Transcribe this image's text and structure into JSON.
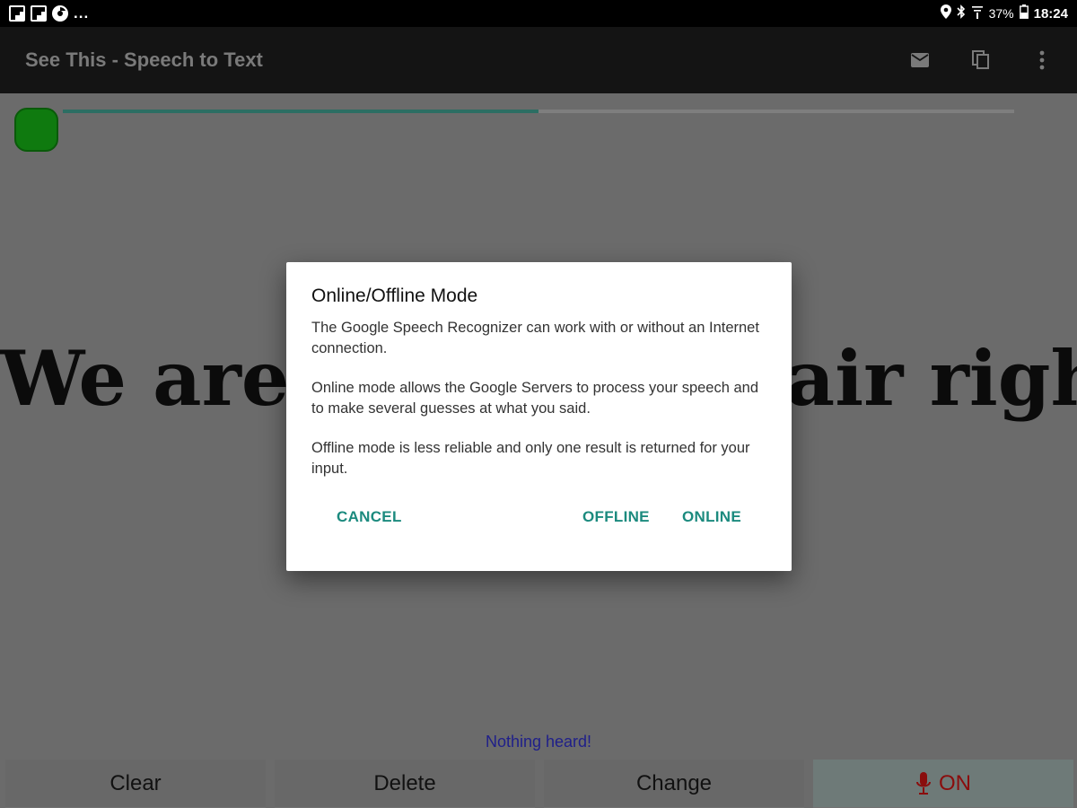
{
  "status_bar": {
    "icons_left": [
      "flipboard-icon",
      "flipboard-icon",
      "chrome-icon"
    ],
    "overflow": "...",
    "icons_right": [
      "location-icon",
      "bluetooth-icon",
      "wifi-icon"
    ],
    "battery": "37%",
    "time": "18:24"
  },
  "app_bar": {
    "title": "See This - Speech to Text",
    "actions": [
      "mail-icon",
      "copy-icon",
      "more-vert-icon"
    ]
  },
  "progress": {
    "value": 0.5,
    "fill_color": "#2c6e63",
    "indicator_color": "#0f7a0f"
  },
  "spoken_text": "We are live on the air right now.",
  "status_message": "Nothing heard!",
  "buttons": {
    "clear": "Clear",
    "delete": "Delete",
    "change": "Change",
    "on": "ON"
  },
  "dialog": {
    "title": "Online/Offline Mode",
    "paragraphs": [
      "The Google Speech Recognizer can work with or without an Internet connection.",
      "Online mode allows the Google Servers to process your speech and to make several guesses at what you said.",
      "Offline mode is less reliable and only one result is returned for your input."
    ],
    "cancel": "CANCEL",
    "offline": "OFFLINE",
    "online": "ONLINE",
    "accent_color": "#1b8a7e"
  }
}
